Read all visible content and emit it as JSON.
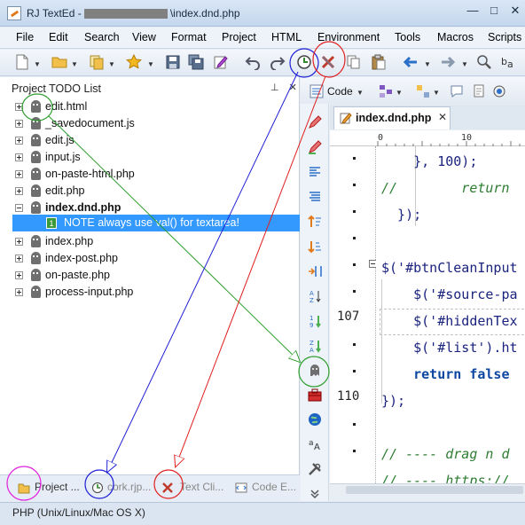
{
  "window": {
    "title_prefix": "RJ TextEd -",
    "title_suffix": "\\index.dnd.php",
    "minimize": "—",
    "maximize": "□",
    "close": "✕"
  },
  "menu": [
    "File",
    "Edit",
    "Search",
    "View",
    "Format",
    "Project",
    "HTML",
    "Environment",
    "Tools",
    "Macros",
    "Scripts"
  ],
  "toolbar": {
    "icons": [
      "new-file-icon",
      "open-folder-icon",
      "copy-docs-icon",
      "favorites-star-icon",
      "save-icon",
      "save-all-icon",
      "edit-document-icon",
      "undo-icon",
      "redo-icon",
      "clock-history-icon",
      "cross-icon",
      "copy-icon",
      "paste-icon",
      "back-arrow-icon",
      "forward-arrow-icon",
      "magnify-icon",
      "replace-icon"
    ]
  },
  "todo_panel": {
    "title": "Project TODO List",
    "pin": "⊥",
    "close": "✕",
    "files": [
      {
        "name": "edit.html",
        "bold": false,
        "expanded": false
      },
      {
        "name": "_savedocument.js",
        "bold": false,
        "expanded": false
      },
      {
        "name": "edit.js",
        "bold": false,
        "expanded": false
      },
      {
        "name": "input.js",
        "bold": false,
        "expanded": false
      },
      {
        "name": "on-paste-html.php",
        "bold": false,
        "expanded": false
      },
      {
        "name": "edit.php",
        "bold": false,
        "expanded": false
      },
      {
        "name": "index.dnd.php",
        "bold": true,
        "expanded": true
      },
      {
        "name": "index.php",
        "bold": false,
        "expanded": false
      },
      {
        "name": "index-post.php",
        "bold": false,
        "expanded": false
      },
      {
        "name": "on-paste.php",
        "bold": false,
        "expanded": false
      },
      {
        "name": "process-input.php",
        "bold": false,
        "expanded": false
      }
    ],
    "note": {
      "number": "1",
      "text": "NOTE always use val() for textarea!"
    }
  },
  "bottom_tabs": [
    {
      "label": "Project ...",
      "icon": "folder-icon"
    },
    {
      "label": "cork.rjp...",
      "icon": "clock-history-icon"
    },
    {
      "label": "Text Cli...",
      "icon": "cross-icon"
    },
    {
      "label": "Code E...",
      "icon": "code-icon"
    }
  ],
  "status": {
    "text": "PHP (Unix/Linux/Mac OS X)"
  },
  "editor": {
    "code_dropdown": "Code",
    "tab_name": "index.dnd.php",
    "tab_close": "✕",
    "ruler": [
      "0",
      "10"
    ],
    "lines": [
      {
        "text": "    }, 100);",
        "type": "code",
        "num": ""
      },
      {
        "text": "//        return",
        "type": "comment",
        "num": ""
      },
      {
        "text": "  });",
        "type": "code",
        "num": ""
      },
      {
        "text": "",
        "type": "code",
        "num": ""
      },
      {
        "text": "$('#btnCleanInput",
        "type": "code",
        "num": ""
      },
      {
        "text": "    $('#source-pa",
        "type": "code",
        "num": ""
      },
      {
        "text": "    $('#hiddenTex",
        "type": "code",
        "num": "107"
      },
      {
        "text": "    $('#list').ht",
        "type": "code",
        "num": ""
      },
      {
        "text": "    return false",
        "type": "keyword",
        "num": ""
      },
      {
        "text": "});",
        "type": "code",
        "num": "110"
      },
      {
        "text": "",
        "type": "code",
        "num": ""
      },
      {
        "text": "// ---- drag n d",
        "type": "comment",
        "num": ""
      },
      {
        "text": "// ---- https://",
        "type": "comment",
        "num": ""
      }
    ]
  },
  "colors": {
    "selection": "#3399ff",
    "annotation_green": "#2e9e2e",
    "annotation_blue": "#1f1fd6",
    "annotation_red": "#e01f1f",
    "annotation_magenta": "#e020e0"
  }
}
